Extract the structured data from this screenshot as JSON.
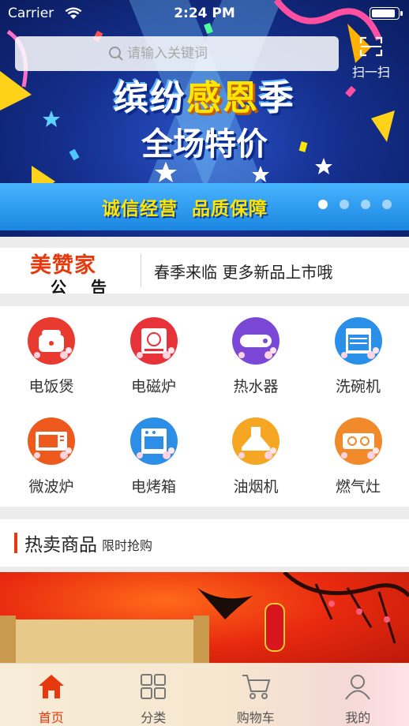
{
  "status_bar": {
    "carrier": "Carrier",
    "time": "2:24 PM",
    "battery_level": 0.95
  },
  "search": {
    "placeholder": "请输入关键词"
  },
  "scan": {
    "label": "扫一扫"
  },
  "banner": {
    "title_white": "缤纷",
    "title_yellow": "感恩",
    "title_end": "季",
    "subtitle": "全场特价",
    "strip_text": "诚信经营  品质保障",
    "dot_count": 4,
    "active_dot": 0
  },
  "notice": {
    "brand": "美赞家",
    "label": "公 告",
    "text": "春季来临 更多新品上市哦"
  },
  "categories": [
    {
      "label": "电饭煲",
      "color": "#e83a2e",
      "icon": "rice-cooker-icon"
    },
    {
      "label": "电磁炉",
      "color": "#e8323a",
      "icon": "induction-cooker-icon"
    },
    {
      "label": "热水器",
      "color": "#7b47d6",
      "icon": "water-heater-icon"
    },
    {
      "label": "洗碗机",
      "color": "#2a8fe6",
      "icon": "dishwasher-icon"
    },
    {
      "label": "微波炉",
      "color": "#ee5a1e",
      "icon": "microwave-icon"
    },
    {
      "label": "电烤箱",
      "color": "#2c8ee6",
      "icon": "oven-icon"
    },
    {
      "label": "油烟机",
      "color": "#f5a623",
      "icon": "range-hood-icon"
    },
    {
      "label": "燃气灶",
      "color": "#f08a2a",
      "icon": "gas-stove-icon"
    }
  ],
  "hot": {
    "title": "热卖商品",
    "subtitle": "限时抢购"
  },
  "tabs": [
    {
      "label": "首页",
      "icon": "home-icon",
      "active": true
    },
    {
      "label": "分类",
      "icon": "grid-icon",
      "active": false
    },
    {
      "label": "购物车",
      "icon": "cart-icon",
      "active": false
    },
    {
      "label": "我的",
      "icon": "user-icon",
      "active": false
    }
  ]
}
